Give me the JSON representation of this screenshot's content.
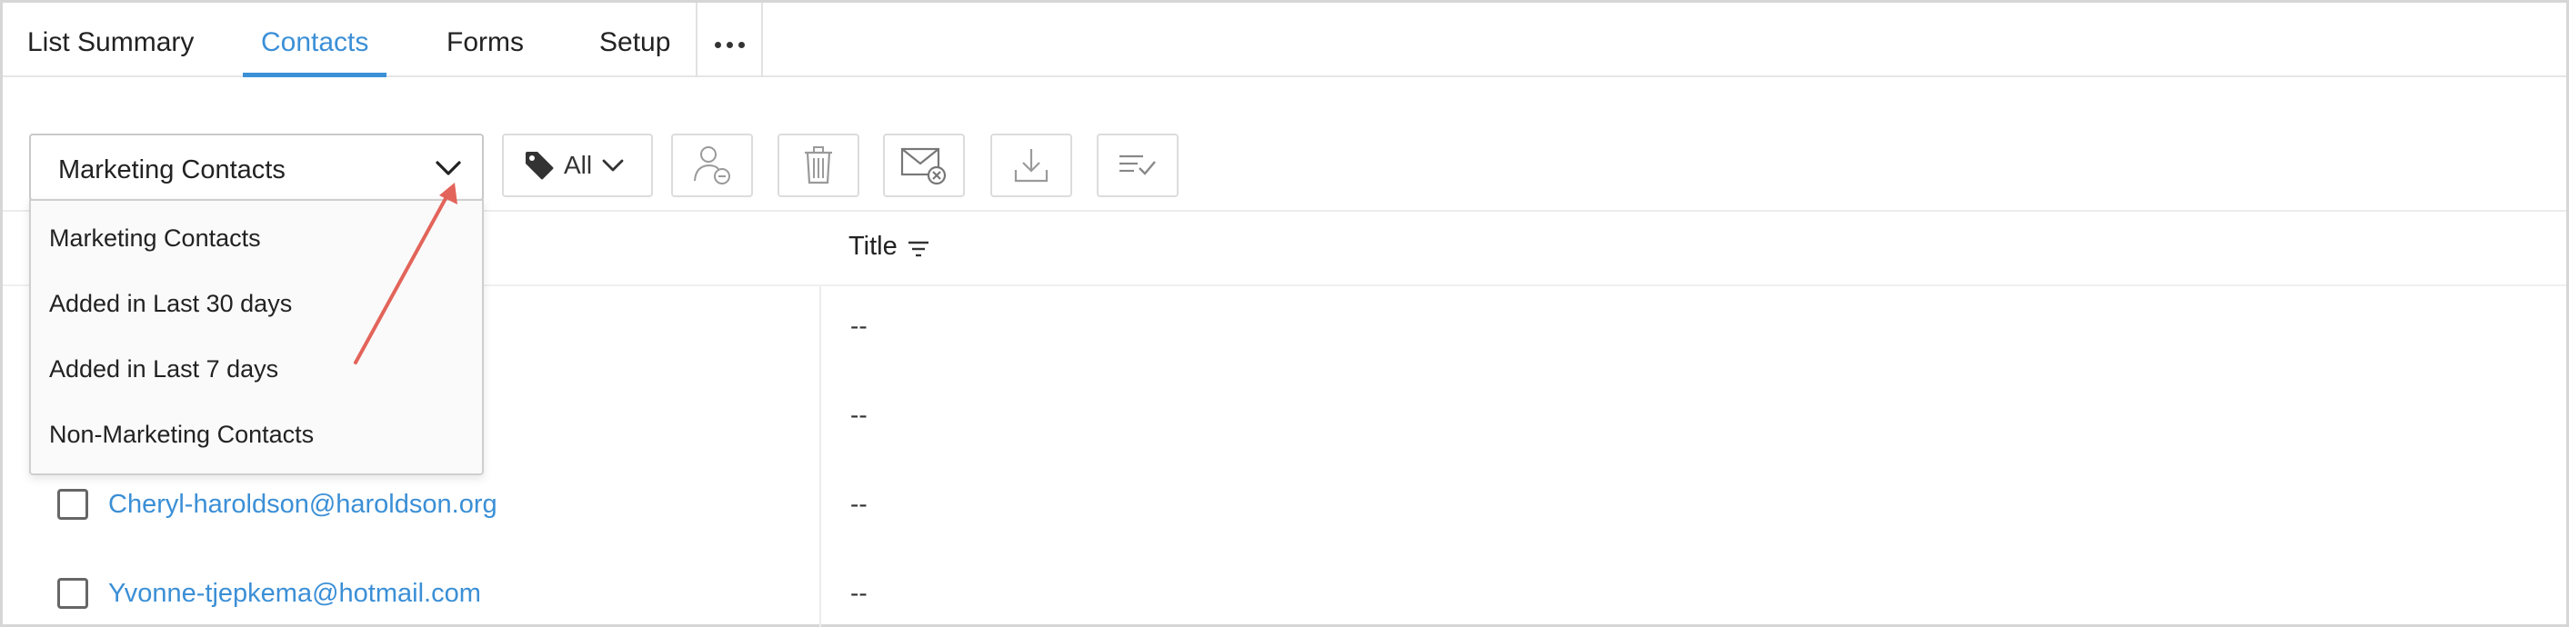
{
  "tabs": [
    {
      "label": "List Summary",
      "active": false
    },
    {
      "label": "Contacts",
      "active": true
    },
    {
      "label": "Forms",
      "active": false
    },
    {
      "label": "Setup",
      "active": false
    }
  ],
  "more_icon": "more-horizontal-icon",
  "filter_dropdown": {
    "selected": "Marketing Contacts",
    "options": [
      "Marketing Contacts",
      "Added in Last 30 days",
      "Added in Last 7 days",
      "Non-Marketing Contacts"
    ]
  },
  "toolbar": {
    "tag_filter_label": "All",
    "icons": [
      "tag-icon",
      "remove-contact-icon",
      "trash-icon",
      "unsubscribe-mail-icon",
      "download-icon",
      "select-list-icon"
    ]
  },
  "table": {
    "title_header": "Title",
    "rows": [
      {
        "email": "",
        "title": "--"
      },
      {
        "email": "",
        "title": "--"
      },
      {
        "email": "Cheryl-haroldson@haroldson.org",
        "title": "--"
      },
      {
        "email": "Yvonne-tjepkema@hotmail.com",
        "title": "--"
      }
    ]
  },
  "colors": {
    "accent": "#3b8fd6",
    "annotation_arrow": "#e3645a"
  }
}
